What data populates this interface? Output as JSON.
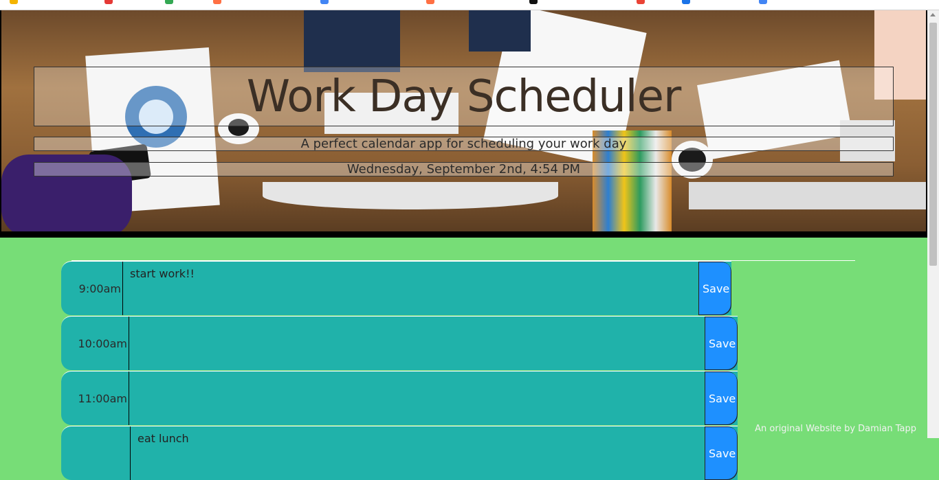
{
  "header": {
    "title": "Work Day Scheduler",
    "lead": "A perfect calendar app for scheduling your work day",
    "current_day": "Wednesday, September 2nd, 4:54 PM"
  },
  "schedule": {
    "rows": [
      {
        "hour": "9:00am",
        "text": "start work!!",
        "save_label": "Save"
      },
      {
        "hour": "10:00am",
        "text": "",
        "save_label": "Save"
      },
      {
        "hour": "11:00am",
        "text": "",
        "save_label": "Save"
      },
      {
        "hour": "",
        "text": "eat lunch",
        "save_label": "Save"
      }
    ]
  },
  "footer": {
    "credit": "An original Website by Damian Tapp"
  },
  "colors": {
    "background": "#77dd77",
    "row": "#20b2aa",
    "save_button": "#1e90ff"
  }
}
